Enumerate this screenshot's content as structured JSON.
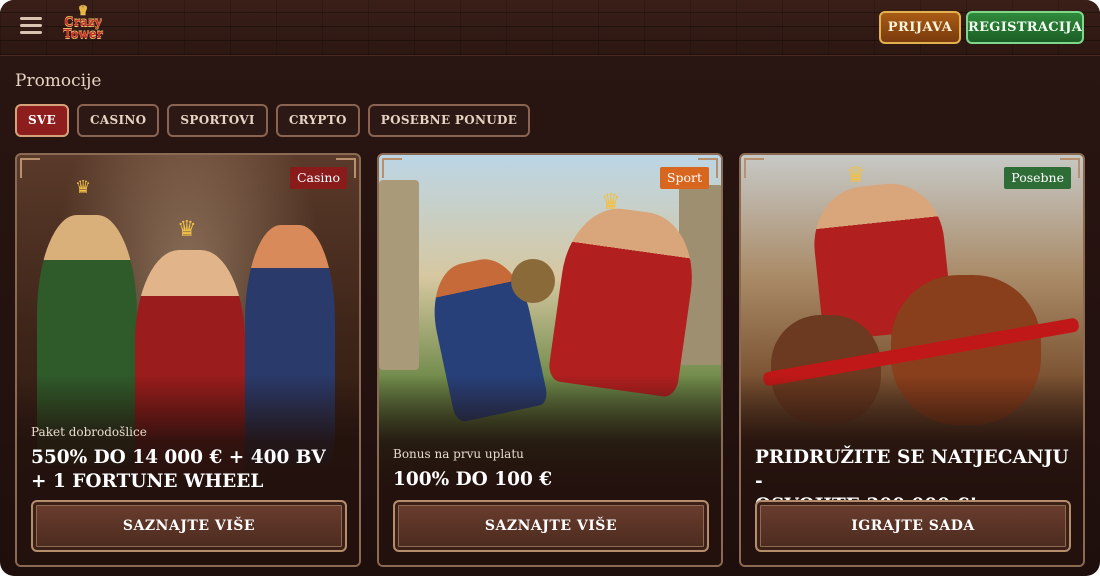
{
  "header": {
    "logo_line1": "Crazy",
    "logo_line2": "Tower",
    "login_label": "PRIJAVA",
    "register_label": "REGISTRACIJA"
  },
  "section_title": "Promocije",
  "filters": [
    {
      "label": "SVE",
      "active": true
    },
    {
      "label": "CASINO",
      "active": false
    },
    {
      "label": "SPORTOVI",
      "active": false
    },
    {
      "label": "CRYPTO",
      "active": false
    },
    {
      "label": "POSEBNE PONUDE",
      "active": false
    }
  ],
  "cards": [
    {
      "tag": "Casino",
      "subtitle": "Paket dobrodošlice",
      "headline_line1": "550% DO 14 000 € + 400 BV",
      "headline_line2": "+ 1 FORTUNE WHEEL",
      "cta": "SAZNAJTE VIŠE"
    },
    {
      "tag": "Sport",
      "subtitle": "Bonus na prvu uplatu",
      "headline_line1": "100% DO 100 €",
      "headline_line2": "",
      "cta": "SAZNAJTE VIŠE"
    },
    {
      "tag": "Posebne",
      "subtitle": "",
      "headline_line1": "PRIDRUŽITE SE NATJECANJU -",
      "headline_line2": "OSVOJITE 300 000 €!",
      "cta": "IGRAJTE SADA"
    }
  ],
  "icons": {
    "menu": "hamburger-menu-icon",
    "crown": "crown-icon"
  },
  "colors": {
    "tag_casino": "#8a1b1b",
    "tag_sport": "#d9661f",
    "tag_posebne": "#2e6e36",
    "login_button": "#a85b14",
    "register_button": "#2f8a3b",
    "active_filter": "#8e1e1e"
  }
}
